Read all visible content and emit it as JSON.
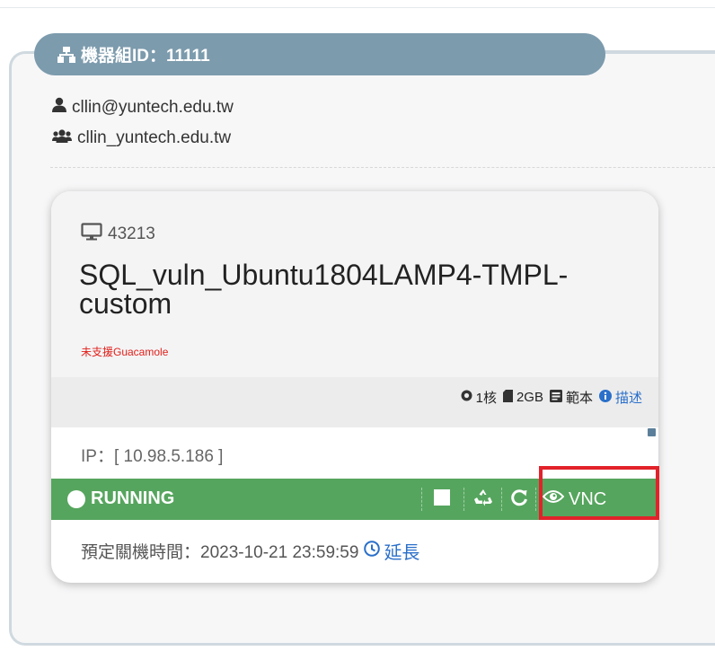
{
  "group": {
    "title": "機器組ID：11111",
    "owner_email": "cllin@yuntech.edu.tw",
    "owner_group": "cllin_yuntech.edu.tw"
  },
  "vm": {
    "id": "43213",
    "name": "SQL_vuln_Ubuntu1804LAMP4-TMPL-custom",
    "warning": "未支援Guacamole",
    "specs": {
      "cpu": "1核",
      "memory": "2GB",
      "template": "範本",
      "description": "描述"
    },
    "ip": "IP：[ 10.98.5.186 ]",
    "status": "RUNNING",
    "vnc_label": "VNC",
    "shutdown_time": "預定關機時間：2023-10-21 23:59:59",
    "extend_label": "延長"
  },
  "icons": {
    "group": "sitemap-icon",
    "owner": "user-icon",
    "members": "users-icon",
    "vm": "desktop-icon",
    "cpu": "cpu-icon",
    "memory": "sd-card-icon",
    "template": "template-icon",
    "info": "info-icon",
    "expand": "plus-square-icon",
    "stop": "stop-icon",
    "recycle": "recycle-icon",
    "restart": "restart-icon",
    "vnc": "eye-icon",
    "clock": "clock-icon"
  },
  "colors": {
    "group_tab": "#7c9bad",
    "status_running": "#56a55e",
    "warning": "#e0201a",
    "link": "#2a6fc9",
    "highlight": "#e2222a"
  }
}
